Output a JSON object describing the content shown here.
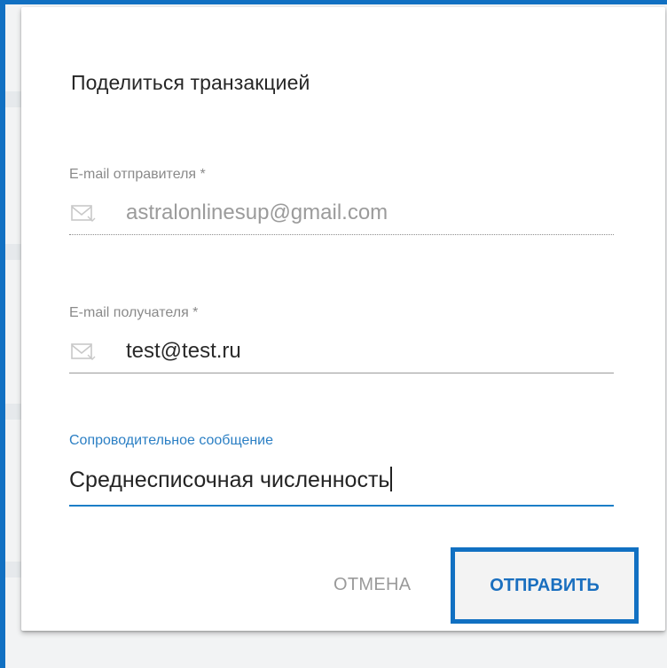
{
  "dialog": {
    "title": "Поделиться транзакцией",
    "sender": {
      "label": "E-mail отправителя *",
      "value": "astralonlinesup@gmail.com",
      "icon": "envelope-icon"
    },
    "recipient": {
      "label": "E-mail получателя *",
      "value": "test@test.ru",
      "icon": "envelope-icon"
    },
    "message": {
      "label": "Сопроводительное сообщение",
      "value": "Среднесписочная численность"
    },
    "buttons": {
      "cancel": "ОТМЕНА",
      "send": "ОТПРАВИТЬ"
    }
  },
  "colors": {
    "accent": "#1c7ec7",
    "frame": "#1170c2",
    "muted_text": "#9a9a9a"
  }
}
